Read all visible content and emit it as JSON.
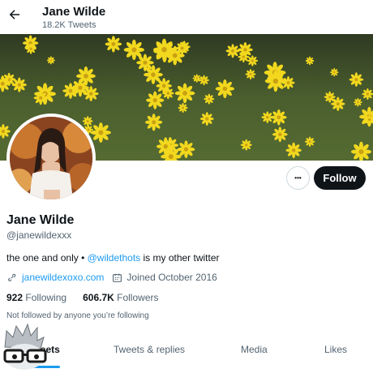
{
  "header": {
    "name": "Jane Wilde",
    "tweet_count": "18.2K Tweets"
  },
  "profile": {
    "name": "Jane Wilde",
    "handle": "@janewildexxx",
    "bio_text": "the one and only • ",
    "bio_mention": "@wildethots",
    "bio_suffix": " is my other twitter",
    "website": "janewildexoxo.com",
    "joined": "Joined October 2016",
    "following_count": "922",
    "following_label": "Following",
    "followers_count": "606.7K",
    "followers_label": "Followers",
    "not_followed": "Not followed by anyone you’re following"
  },
  "actions": {
    "more_label": "•••",
    "follow_label": "Follow"
  },
  "tabs": [
    {
      "label": "Tweets"
    },
    {
      "label": "Tweets & replies"
    },
    {
      "label": "Media"
    },
    {
      "label": "Likes"
    }
  ],
  "colors": {
    "accent": "#1d9bf0",
    "text": "#0f1419",
    "secondary": "#536471"
  }
}
